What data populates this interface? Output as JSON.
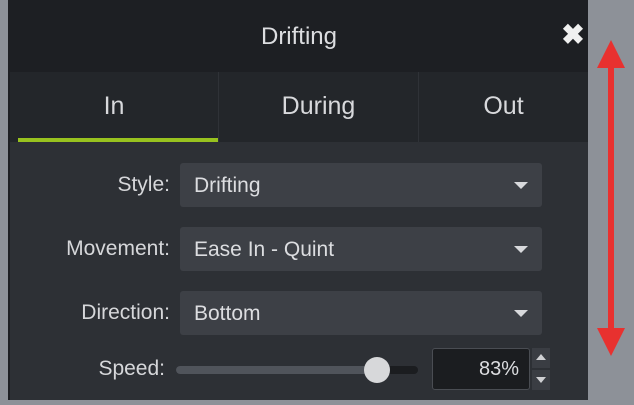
{
  "window": {
    "title": "Drifting",
    "close_icon": "close-icon"
  },
  "tabs": [
    {
      "label": "In",
      "active": true
    },
    {
      "label": "During",
      "active": false
    },
    {
      "label": "Out",
      "active": false
    }
  ],
  "colors": {
    "active_tab_underline": "#98c21f",
    "annotation_arrow": "#e8312f"
  },
  "properties": {
    "style": {
      "label": "Style:",
      "value": "Drifting"
    },
    "movement": {
      "label": "Movement:",
      "value": "Ease In - Quint"
    },
    "direction": {
      "label": "Direction:",
      "value": "Bottom"
    },
    "speed": {
      "label": "Speed:",
      "value": "83%",
      "level": 0.83
    }
  },
  "annotation": {
    "icon": "double-headed-vertical-arrow"
  }
}
